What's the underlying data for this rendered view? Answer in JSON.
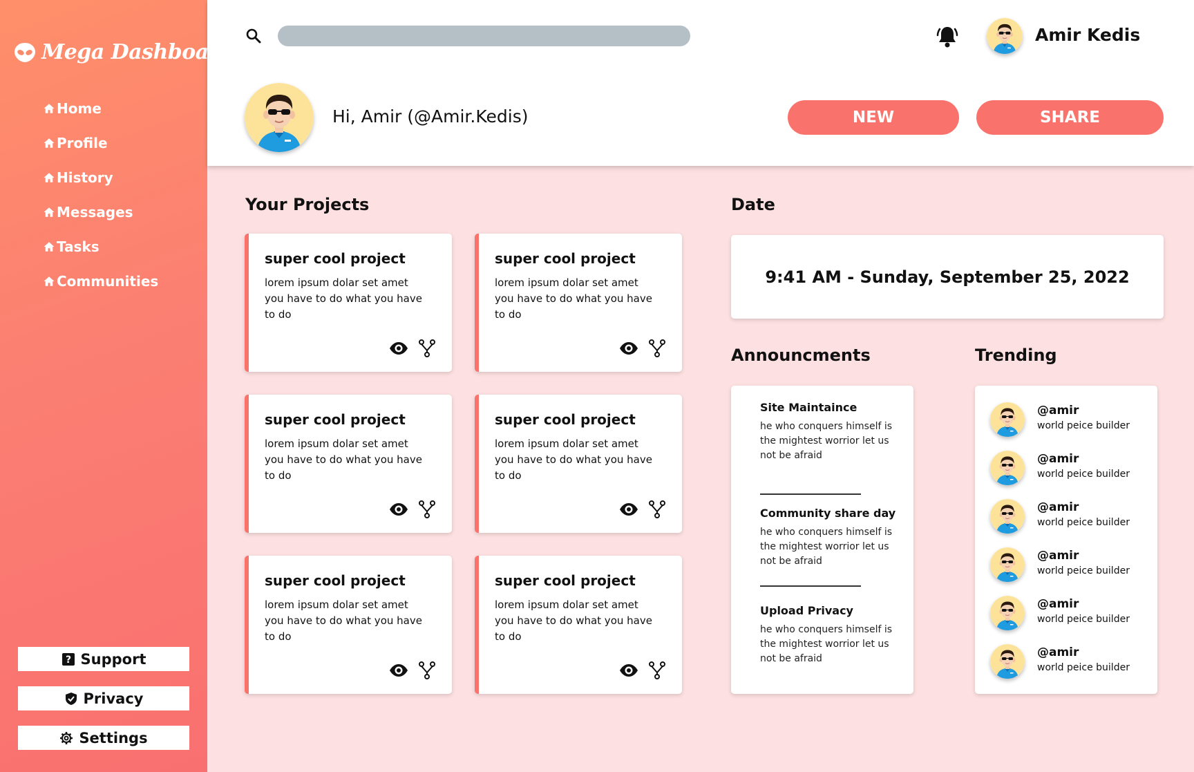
{
  "app": {
    "title": "Mega Dashboard"
  },
  "sidebar": {
    "nav": [
      {
        "label": "Home",
        "icon": "home-icon"
      },
      {
        "label": "Profile",
        "icon": "home-icon"
      },
      {
        "label": "History",
        "icon": "home-icon"
      },
      {
        "label": "Messages",
        "icon": "home-icon"
      },
      {
        "label": "Tasks",
        "icon": "home-icon"
      },
      {
        "label": "Communities",
        "icon": "home-icon"
      }
    ],
    "support_label": "Support",
    "privacy_label": "Privacy",
    "settings_label": "Settings"
  },
  "header": {
    "search_value": "",
    "user_name": "Amir Kedis",
    "greeting": "Hi, Amir (@Amir.Kedis)",
    "new_label": "NEW",
    "share_label": "SHARE"
  },
  "projects": {
    "title": "Your Projects",
    "cards": [
      {
        "title": "super cool project",
        "desc": "lorem ipsum dolar set amet you have to do what you have to do"
      },
      {
        "title": "super cool project",
        "desc": "lorem ipsum dolar set amet you have to do what you have to do"
      },
      {
        "title": "super cool project",
        "desc": "lorem ipsum dolar set amet you have to do what you have to do"
      },
      {
        "title": "super cool project",
        "desc": "lorem ipsum dolar set amet you have to do what you have to do"
      },
      {
        "title": "super cool project",
        "desc": "lorem ipsum dolar set amet you have to do what you have to do"
      },
      {
        "title": "super cool project",
        "desc": "lorem ipsum dolar set amet you have to do what you have to do"
      }
    ]
  },
  "date": {
    "title": "Date",
    "value": "9:41 AM - Sunday, September 25, 2022"
  },
  "announcements": {
    "title": "Announcments",
    "items": [
      {
        "title": "Site Maintaince",
        "text": "he who conquers himself is the mightest worrior let us not be afraid"
      },
      {
        "title": "Community share day",
        "text": "he who conquers himself is the mightest worrior let us not be afraid"
      },
      {
        "title": "Upload Privacy",
        "text": "he who conquers himself is the mightest worrior let us not be afraid"
      }
    ]
  },
  "trending": {
    "title": "Trending",
    "items": [
      {
        "handle": "@amir",
        "subtitle": "world peice builder"
      },
      {
        "handle": "@amir",
        "subtitle": "world peice builder"
      },
      {
        "handle": "@amir",
        "subtitle": "world peice builder"
      },
      {
        "handle": "@amir",
        "subtitle": "world peice builder"
      },
      {
        "handle": "@amir",
        "subtitle": "world peice builder"
      },
      {
        "handle": "@amir",
        "subtitle": "world peice builder"
      }
    ]
  },
  "colors": {
    "accent": "#f9736c",
    "sidebar_top": "#ff8f6a",
    "sidebar_bottom": "#f97070",
    "page_bg": "#fde0e1",
    "search_bar": "#b4bfc6"
  }
}
